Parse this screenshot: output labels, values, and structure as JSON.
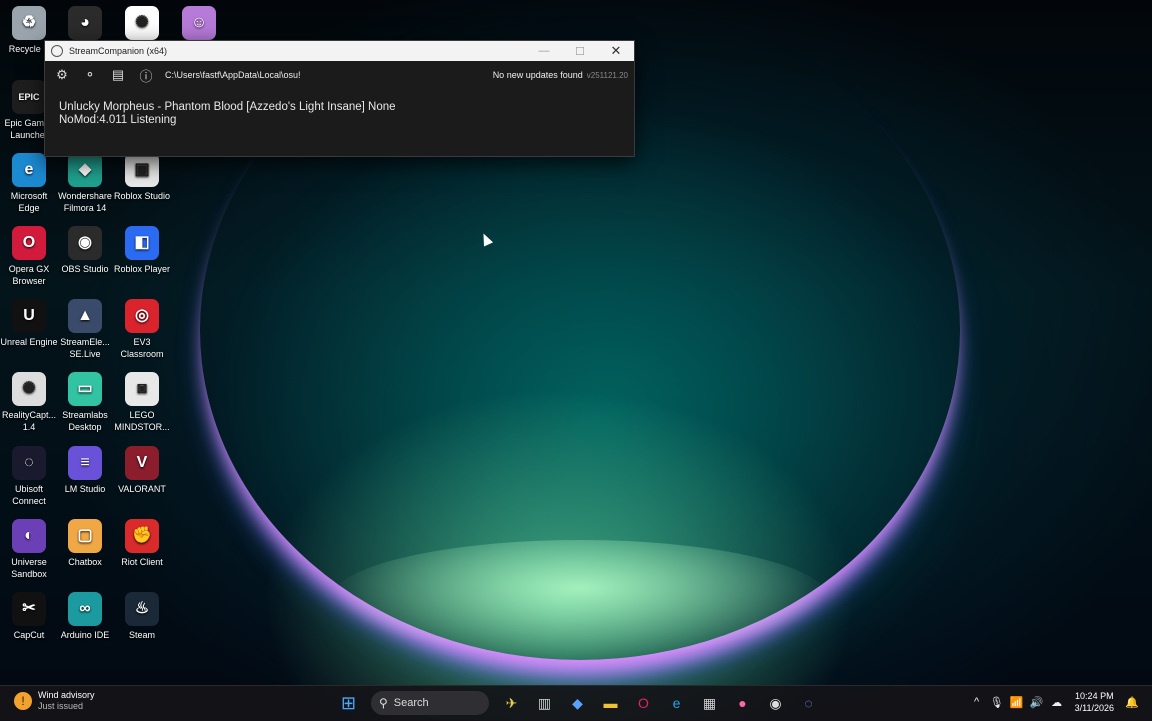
{
  "desktop": {
    "icons": [
      {
        "label": "Recycle B",
        "col": 0,
        "row": 0,
        "color": "#9aa4ad",
        "glyph": "♻"
      },
      {
        "label": "",
        "col": 1,
        "row": 0,
        "color": "#2b2b2b",
        "glyph": "◕"
      },
      {
        "label": "",
        "col": 2,
        "row": 0,
        "color": "#ffffff",
        "glyph": "✺"
      },
      {
        "label": "",
        "col": 3,
        "row": 0,
        "color": "#b67ad8",
        "glyph": "☺"
      },
      {
        "label": "Epic Games Launcher",
        "col": 0,
        "row": 1,
        "color": "#1e1e1e",
        "glyph": "EPIC"
      },
      {
        "label": "Microsoft Edge",
        "col": 0,
        "row": 2,
        "color": "#1c8ad1",
        "glyph": "e"
      },
      {
        "label": "Wondershare Filmora 14",
        "col": 1,
        "row": 2,
        "color": "#1fa18f",
        "glyph": "◆"
      },
      {
        "label": "Roblox Studio",
        "col": 2,
        "row": 2,
        "color": "#e8e8e8",
        "glyph": "▣"
      },
      {
        "label": "Opera GX Browser",
        "col": 0,
        "row": 3,
        "color": "#d21b3c",
        "glyph": "O"
      },
      {
        "label": "OBS Studio",
        "col": 1,
        "row": 3,
        "color": "#2b2b2b",
        "glyph": "◉"
      },
      {
        "label": "Roblox Player",
        "col": 2,
        "row": 3,
        "color": "#2a6bf2",
        "glyph": "◧"
      },
      {
        "label": "Unreal Engine",
        "col": 0,
        "row": 4,
        "color": "#111111",
        "glyph": "U"
      },
      {
        "label": "StreamEle... SE.Live",
        "col": 1,
        "row": 4,
        "color": "#3a4a6a",
        "glyph": "▲"
      },
      {
        "label": "EV3 Classroom",
        "col": 2,
        "row": 4,
        "color": "#d9232d",
        "glyph": "◎"
      },
      {
        "label": "RealityCapt... 1.4",
        "col": 0,
        "row": 5,
        "color": "#dddddd",
        "glyph": "✺"
      },
      {
        "label": "Streamlabs Desktop",
        "col": 1,
        "row": 5,
        "color": "#31c3a2",
        "glyph": "▭"
      },
      {
        "label": "LEGO MINDSTOR...",
        "col": 2,
        "row": 5,
        "color": "#e8e8e8",
        "glyph": "◙"
      },
      {
        "label": "Ubisoft Connect",
        "col": 0,
        "row": 6,
        "color": "#1a1a2e",
        "glyph": "◌"
      },
      {
        "label": "LM Studio",
        "col": 1,
        "row": 6,
        "color": "#6a52d8",
        "glyph": "≡"
      },
      {
        "label": "VALORANT",
        "col": 2,
        "row": 6,
        "color": "#8b1d2c",
        "glyph": "V"
      },
      {
        "label": "Universe Sandbox",
        "col": 0,
        "row": 7,
        "color": "#6b3fb5",
        "glyph": "◐"
      },
      {
        "label": "Chatbox",
        "col": 1,
        "row": 7,
        "color": "#f0a847",
        "glyph": "▢"
      },
      {
        "label": "Riot Client",
        "col": 2,
        "row": 7,
        "color": "#d92b2b",
        "glyph": "✊"
      },
      {
        "label": "CapCut",
        "col": 0,
        "row": 8,
        "color": "#111111",
        "glyph": "✂"
      },
      {
        "label": "Arduino IDE",
        "col": 1,
        "row": 8,
        "color": "#1b9aa0",
        "glyph": "∞"
      },
      {
        "label": "Steam",
        "col": 2,
        "row": 8,
        "color": "#1b2838",
        "glyph": "♨"
      }
    ]
  },
  "window": {
    "title": "StreamCompanion (x64)",
    "controls": {
      "minimize": "—",
      "maximize": "☐",
      "close": "✕"
    },
    "toolbar": {
      "settings_icon": "⚙",
      "osu_icon": "⚬",
      "clipboard_icon": "▤",
      "info_icon": "ⓘ",
      "path": "C:\\Users\\fastf\\AppData\\Local\\osu!",
      "update_status": "No new updates found",
      "version": "v251121.20"
    },
    "status_line1": "Unlucky Morpheus - Phantom Blood [Azzedo's Light Insane] None",
    "status_line2": "NoMod:4.011 Listening"
  },
  "taskbar": {
    "weather_title": "Wind advisory",
    "weather_sub": "Just issued",
    "search_label": "Search",
    "start_glyph": "⊞",
    "search_glyph": "⚲",
    "apps": [
      {
        "name": "plane-app-icon",
        "glyph": "✈",
        "color": "#e8d34a"
      },
      {
        "name": "taskview-icon",
        "glyph": "▥",
        "color": "#cfcfcf"
      },
      {
        "name": "copilot-icon",
        "glyph": "◆",
        "color": "#5aa0ff"
      },
      {
        "name": "file-explorer-icon",
        "glyph": "▬",
        "color": "#f2c230"
      },
      {
        "name": "opera-gx-icon",
        "glyph": "O",
        "color": "#e0245e"
      },
      {
        "name": "edge-icon",
        "glyph": "e",
        "color": "#27a3e0"
      },
      {
        "name": "store-icon",
        "glyph": "▦",
        "color": "#cfcfcf"
      },
      {
        "name": "osu-icon",
        "glyph": "●",
        "color": "#ff66aa"
      },
      {
        "name": "obs-icon",
        "glyph": "◉",
        "color": "#dddddd"
      },
      {
        "name": "streamcompanion-icon",
        "glyph": "◌",
        "color": "#9aa0ff"
      }
    ],
    "tray": {
      "chevron": "^",
      "mic": "🎙",
      "wifi": "📶",
      "volume": "🔊",
      "cloud": "☁",
      "time": "10:24 PM",
      "date": "3/11/2026",
      "notification": "🔔"
    }
  }
}
